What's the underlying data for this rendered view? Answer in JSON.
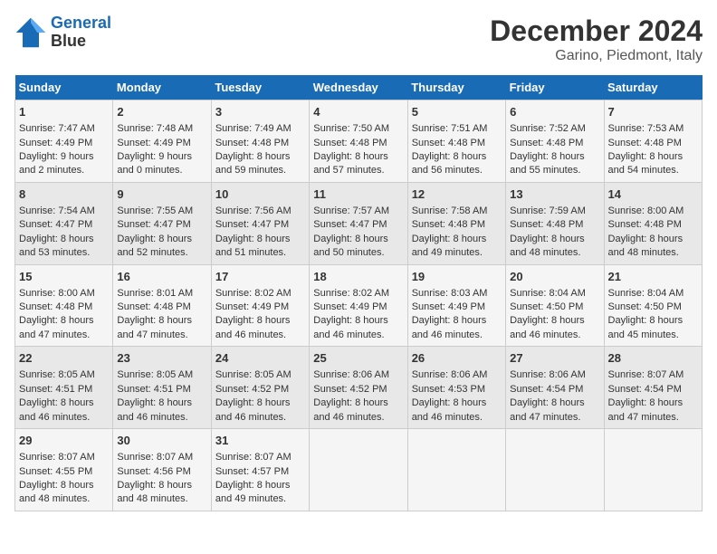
{
  "header": {
    "logo_line1": "General",
    "logo_line2": "Blue",
    "title": "December 2024",
    "subtitle": "Garino, Piedmont, Italy"
  },
  "weekdays": [
    "Sunday",
    "Monday",
    "Tuesday",
    "Wednesday",
    "Thursday",
    "Friday",
    "Saturday"
  ],
  "weeks": [
    [
      {
        "day": "1",
        "lines": [
          "Sunrise: 7:47 AM",
          "Sunset: 4:49 PM",
          "Daylight: 9 hours",
          "and 2 minutes."
        ]
      },
      {
        "day": "2",
        "lines": [
          "Sunrise: 7:48 AM",
          "Sunset: 4:49 PM",
          "Daylight: 9 hours",
          "and 0 minutes."
        ]
      },
      {
        "day": "3",
        "lines": [
          "Sunrise: 7:49 AM",
          "Sunset: 4:48 PM",
          "Daylight: 8 hours",
          "and 59 minutes."
        ]
      },
      {
        "day": "4",
        "lines": [
          "Sunrise: 7:50 AM",
          "Sunset: 4:48 PM",
          "Daylight: 8 hours",
          "and 57 minutes."
        ]
      },
      {
        "day": "5",
        "lines": [
          "Sunrise: 7:51 AM",
          "Sunset: 4:48 PM",
          "Daylight: 8 hours",
          "and 56 minutes."
        ]
      },
      {
        "day": "6",
        "lines": [
          "Sunrise: 7:52 AM",
          "Sunset: 4:48 PM",
          "Daylight: 8 hours",
          "and 55 minutes."
        ]
      },
      {
        "day": "7",
        "lines": [
          "Sunrise: 7:53 AM",
          "Sunset: 4:48 PM",
          "Daylight: 8 hours",
          "and 54 minutes."
        ]
      }
    ],
    [
      {
        "day": "8",
        "lines": [
          "Sunrise: 7:54 AM",
          "Sunset: 4:47 PM",
          "Daylight: 8 hours",
          "and 53 minutes."
        ]
      },
      {
        "day": "9",
        "lines": [
          "Sunrise: 7:55 AM",
          "Sunset: 4:47 PM",
          "Daylight: 8 hours",
          "and 52 minutes."
        ]
      },
      {
        "day": "10",
        "lines": [
          "Sunrise: 7:56 AM",
          "Sunset: 4:47 PM",
          "Daylight: 8 hours",
          "and 51 minutes."
        ]
      },
      {
        "day": "11",
        "lines": [
          "Sunrise: 7:57 AM",
          "Sunset: 4:47 PM",
          "Daylight: 8 hours",
          "and 50 minutes."
        ]
      },
      {
        "day": "12",
        "lines": [
          "Sunrise: 7:58 AM",
          "Sunset: 4:48 PM",
          "Daylight: 8 hours",
          "and 49 minutes."
        ]
      },
      {
        "day": "13",
        "lines": [
          "Sunrise: 7:59 AM",
          "Sunset: 4:48 PM",
          "Daylight: 8 hours",
          "and 48 minutes."
        ]
      },
      {
        "day": "14",
        "lines": [
          "Sunrise: 8:00 AM",
          "Sunset: 4:48 PM",
          "Daylight: 8 hours",
          "and 48 minutes."
        ]
      }
    ],
    [
      {
        "day": "15",
        "lines": [
          "Sunrise: 8:00 AM",
          "Sunset: 4:48 PM",
          "Daylight: 8 hours",
          "and 47 minutes."
        ]
      },
      {
        "day": "16",
        "lines": [
          "Sunrise: 8:01 AM",
          "Sunset: 4:48 PM",
          "Daylight: 8 hours",
          "and 47 minutes."
        ]
      },
      {
        "day": "17",
        "lines": [
          "Sunrise: 8:02 AM",
          "Sunset: 4:49 PM",
          "Daylight: 8 hours",
          "and 46 minutes."
        ]
      },
      {
        "day": "18",
        "lines": [
          "Sunrise: 8:02 AM",
          "Sunset: 4:49 PM",
          "Daylight: 8 hours",
          "and 46 minutes."
        ]
      },
      {
        "day": "19",
        "lines": [
          "Sunrise: 8:03 AM",
          "Sunset: 4:49 PM",
          "Daylight: 8 hours",
          "and 46 minutes."
        ]
      },
      {
        "day": "20",
        "lines": [
          "Sunrise: 8:04 AM",
          "Sunset: 4:50 PM",
          "Daylight: 8 hours",
          "and 46 minutes."
        ]
      },
      {
        "day": "21",
        "lines": [
          "Sunrise: 8:04 AM",
          "Sunset: 4:50 PM",
          "Daylight: 8 hours",
          "and 45 minutes."
        ]
      }
    ],
    [
      {
        "day": "22",
        "lines": [
          "Sunrise: 8:05 AM",
          "Sunset: 4:51 PM",
          "Daylight: 8 hours",
          "and 46 minutes."
        ]
      },
      {
        "day": "23",
        "lines": [
          "Sunrise: 8:05 AM",
          "Sunset: 4:51 PM",
          "Daylight: 8 hours",
          "and 46 minutes."
        ]
      },
      {
        "day": "24",
        "lines": [
          "Sunrise: 8:05 AM",
          "Sunset: 4:52 PM",
          "Daylight: 8 hours",
          "and 46 minutes."
        ]
      },
      {
        "day": "25",
        "lines": [
          "Sunrise: 8:06 AM",
          "Sunset: 4:52 PM",
          "Daylight: 8 hours",
          "and 46 minutes."
        ]
      },
      {
        "day": "26",
        "lines": [
          "Sunrise: 8:06 AM",
          "Sunset: 4:53 PM",
          "Daylight: 8 hours",
          "and 46 minutes."
        ]
      },
      {
        "day": "27",
        "lines": [
          "Sunrise: 8:06 AM",
          "Sunset: 4:54 PM",
          "Daylight: 8 hours",
          "and 47 minutes."
        ]
      },
      {
        "day": "28",
        "lines": [
          "Sunrise: 8:07 AM",
          "Sunset: 4:54 PM",
          "Daylight: 8 hours",
          "and 47 minutes."
        ]
      }
    ],
    [
      {
        "day": "29",
        "lines": [
          "Sunrise: 8:07 AM",
          "Sunset: 4:55 PM",
          "Daylight: 8 hours",
          "and 48 minutes."
        ]
      },
      {
        "day": "30",
        "lines": [
          "Sunrise: 8:07 AM",
          "Sunset: 4:56 PM",
          "Daylight: 8 hours",
          "and 48 minutes."
        ]
      },
      {
        "day": "31",
        "lines": [
          "Sunrise: 8:07 AM",
          "Sunset: 4:57 PM",
          "Daylight: 8 hours",
          "and 49 minutes."
        ]
      },
      {
        "day": "",
        "lines": []
      },
      {
        "day": "",
        "lines": []
      },
      {
        "day": "",
        "lines": []
      },
      {
        "day": "",
        "lines": []
      }
    ]
  ]
}
